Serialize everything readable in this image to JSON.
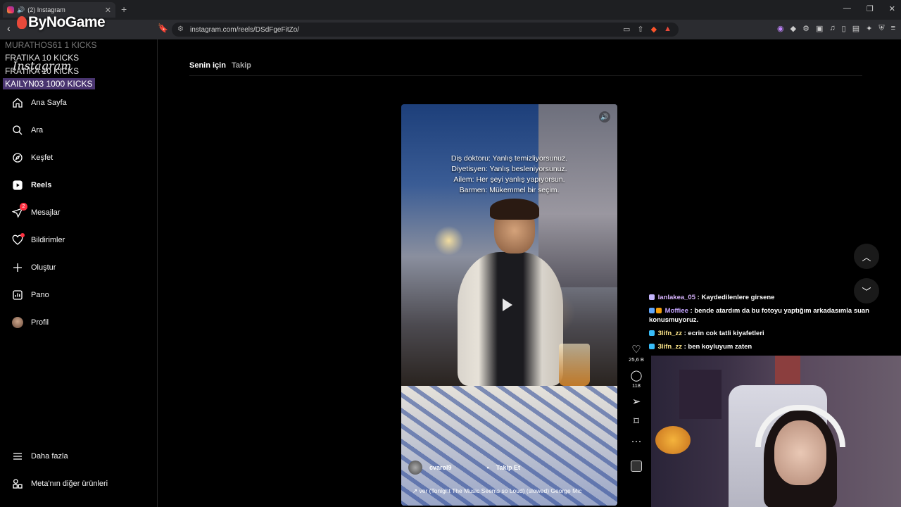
{
  "browser": {
    "tab_title": "(2) Instagram",
    "url": "instagram.com/reels/DSdFgeFitZo/"
  },
  "overlay": {
    "brand": "ByNoGame",
    "kicks": [
      {
        "text": "MURATHOS61  1 KICKS"
      },
      {
        "text": "FRATIKA  10 KICKS"
      },
      {
        "text": "FRATIKA  10 KICKS"
      },
      {
        "text": "KAILYN03  1000 KICKS"
      }
    ]
  },
  "sidebar": {
    "logo": "Instagram",
    "items": [
      {
        "label": "Ana Sayfa",
        "icon": "home-icon"
      },
      {
        "label": "Ara",
        "icon": "search-icon"
      },
      {
        "label": "Keşfet",
        "icon": "compass-icon"
      },
      {
        "label": "Reels",
        "icon": "reels-icon"
      },
      {
        "label": "Mesajlar",
        "icon": "messenger-icon",
        "badge": "2"
      },
      {
        "label": "Bildirimler",
        "icon": "heart-icon"
      },
      {
        "label": "Oluştur",
        "icon": "plus-icon"
      },
      {
        "label": "Pano",
        "icon": "dashboard-icon"
      },
      {
        "label": "Profil",
        "icon": "avatar"
      }
    ],
    "more": "Daha fazla",
    "meta": "Meta'nın diğer ürünleri"
  },
  "main": {
    "tabs": [
      "Senin için",
      "Takip"
    ],
    "reel": {
      "caption": [
        "Diş doktoru: Yanlış temizliyorsunuz.",
        "Diyetisyen: Yanlış besleniyorsunuz.",
        "Ailem: Her şeyi yanlış yapıyorsun.",
        "Barmen: Mükemmel bir seçim."
      ],
      "author": "cvarol9",
      "follow": "Takip Et",
      "music": "↗ ver (Tonight The Music Seems so Loud) (slowed)  George Mic"
    },
    "actions": {
      "likes": "25,6 B",
      "comments": "118"
    }
  },
  "chat": [
    {
      "user": "lanlakea_05",
      "msg": "Kaydedilenlere girsene"
    },
    {
      "user": "Moffiee",
      "msg": "bende atardım da bu fotoyu yaptığım arkadasımla suan konusmuyoruz."
    },
    {
      "user": "3lifn_zz",
      "msg": "ecrin cok tatli kiyafetleri"
    },
    {
      "user": "3lifn_zz",
      "msg": "ben koyluyum zaten"
    }
  ]
}
